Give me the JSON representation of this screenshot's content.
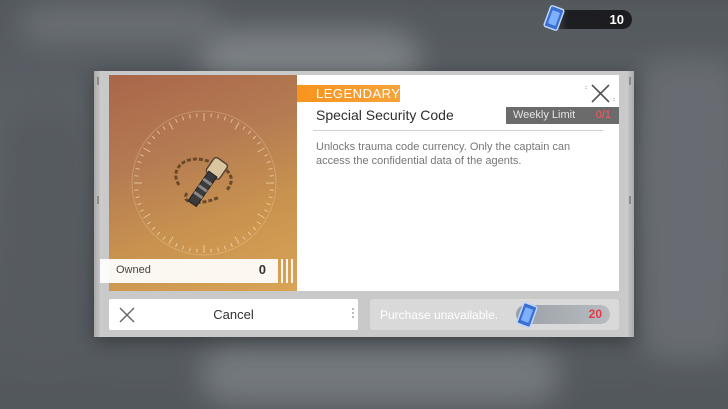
{
  "currency": {
    "amount": "10"
  },
  "item": {
    "rarity": "LEGENDARY",
    "name": "Special Security Code",
    "weekly_limit_label": "Weekly Limit",
    "weekly_limit_value": "0/1",
    "description": "Unlocks trauma code currency. Only the captain can access the confidential data of the agents.",
    "owned_label": "Owned",
    "owned_value": "0"
  },
  "buttons": {
    "cancel_label": "Cancel",
    "purchase_label": "Purchase unavailable.",
    "price": "20"
  },
  "colors": {
    "rarity": "#f7941d",
    "limit_value": "#ff5560",
    "price": "#e53945"
  },
  "icons": [
    "currency-card-icon",
    "close-icon",
    "cancel-x-icon",
    "security-code-item-icon"
  ]
}
